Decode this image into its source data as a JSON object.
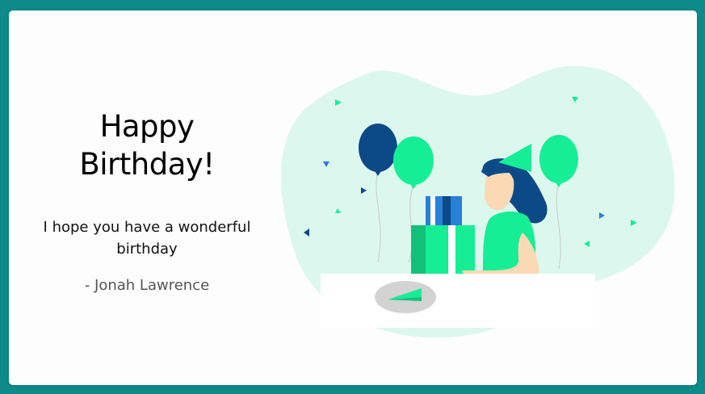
{
  "card": {
    "title": "Happy Birthday!",
    "message": "I hope you have a wonderful birthday",
    "signature": "- Jonah Lawrence"
  },
  "colors": {
    "page_background": "#0e8a8a",
    "card_background": "#fdfdfd",
    "blob": "#dcf8ee",
    "accent_green": "#16ee96",
    "dark_green": "#12c07a",
    "navy": "#0c4a87",
    "blue": "#2a7fd6",
    "skin": "#fbd9b4"
  },
  "illustration": {
    "icon": "birthday-party-illustration"
  }
}
